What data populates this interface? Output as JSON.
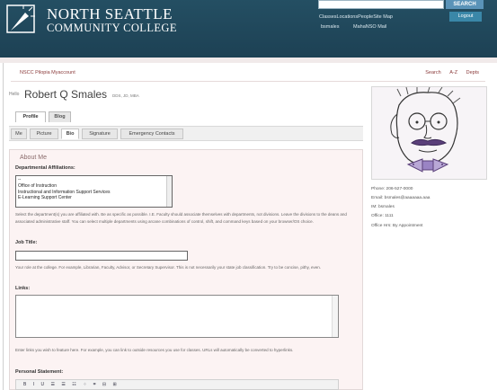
{
  "header": {
    "logo_line1": "NORTH SEATTLE",
    "logo_line2": "COMMUNITY COLLEGE",
    "search_button": "SEARCH",
    "top_links": "ClassesLocationsPeopleSite Map",
    "user_link": "bsmales",
    "mail_link": "MahaNSO Mail",
    "logout_button": "Logout"
  },
  "breadcrumb": "NSCC Pilopia Myaccount",
  "util_nav": [
    "Search",
    "A-Z",
    "Depts"
  ],
  "profile": {
    "name_prefix": "Hello",
    "name": "Robert Q Smales",
    "name_suffix": "DDS, JD, MBA"
  },
  "tabs": [
    {
      "label": "Profile",
      "active": true
    },
    {
      "label": "Blog",
      "active": false
    }
  ],
  "subtabs": [
    {
      "label": "Me",
      "active": false
    },
    {
      "label": "Picture",
      "active": false
    },
    {
      "label": "Bio",
      "active": true
    },
    {
      "label": "Signature",
      "active": false
    },
    {
      "label": "Emergency Contacts",
      "active": false
    }
  ],
  "form": {
    "section_title": "About Me",
    "dept_label": "Departmental Affiliations:",
    "dept_options": [
      "--",
      "Office of Instruction",
      "Instructional and Information Support Services",
      "E-Learning Support Center"
    ],
    "dept_help": "Select the department(s) you are affiliated with. Be as specific as possible. I.E. Faculty should associate themselves with departments, not divisions. Leave the divisions to the deans and associated administrative staff. You can select multiple departments using arcane combinations of control, shift, and command keys based on your browser/OS choice.",
    "job_label": "Job Title:",
    "job_value": "",
    "job_help": "Your role at the college. For example, Librarian, Faculty, Advisor, or Secretary Supervisor. This is not necessarily your state job classification. Try to be concise, pithy, even.",
    "links_label": "Links:",
    "links_value": "",
    "links_help": "Enter links you wish to feature here. For example, you can link to outside resources you use for classes. URLs will automatically be converted to hyperlinks.",
    "statement_label": "Personal Statement:",
    "editor_toolbar": "B I U ☰ ☰ ☷ ⁘ ⌗ ⊟ ⊞"
  },
  "sidebar": {
    "phone": "Phone: 206-527-0000",
    "email": "Email: bsmales@aaaaaaa.aaa",
    "im": "IM: bsmales",
    "office": "Office: 1111",
    "hours": "Office Hrs: By Appointment"
  },
  "colors": {
    "header_bg": "#1d4154",
    "accent_link": "#8a3a3a",
    "panel_bg": "#fcf3f3",
    "search_button": "#5a93b8"
  }
}
